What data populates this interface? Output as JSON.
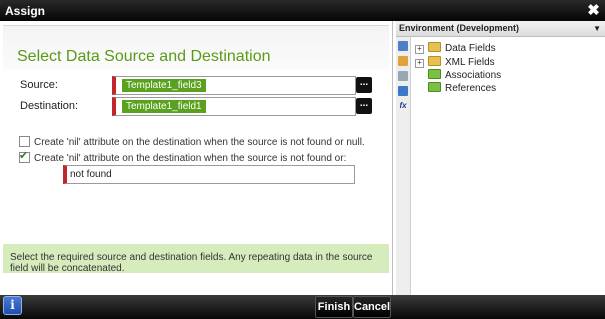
{
  "dialog": {
    "title": "Assign",
    "close_glyph": "✖"
  },
  "main": {
    "heading": "Select Data Source and Destination",
    "source_label": "Source:",
    "source_value": "Template1_field3",
    "destination_label": "Destination:",
    "destination_value": "Template1_field1",
    "browse_label": "...",
    "option1_label": "Create 'nil' attribute on the destination when the source is not found or null.",
    "option1_checked": false,
    "option2_label": "Create 'nil' attribute on the destination when the source is not found or:",
    "option2_checked": true,
    "not_found_value": "not found",
    "hint": "Select the required source and destination fields. Any repeating data in the source field will be concatenated."
  },
  "footer": {
    "info_glyph": "i",
    "finish_label": "Finish",
    "cancel_label": "Cancel"
  },
  "environment": {
    "title": "Environment (Development)",
    "dropdown_glyph": "▼",
    "tree": [
      {
        "label": "Data Fields",
        "expandable": true,
        "icon": "folder-icon"
      },
      {
        "label": "XML Fields",
        "expandable": true,
        "icon": "folder-icon"
      },
      {
        "label": "Associations",
        "expandable": false,
        "icon": "associations-icon"
      },
      {
        "label": "References",
        "expandable": false,
        "icon": "references-icon"
      }
    ],
    "expander_glyph": "+",
    "tools": [
      "context-browser-icon",
      "object-browser-icon",
      "copy-icon",
      "text-icon",
      "expression-icon"
    ],
    "expression_glyph": "fx"
  },
  "colors": {
    "accent_green": "#5aa11d",
    "heading_green": "#5a9a16",
    "required_red": "#c0272d",
    "hint_bg": "#d7ecbd"
  }
}
